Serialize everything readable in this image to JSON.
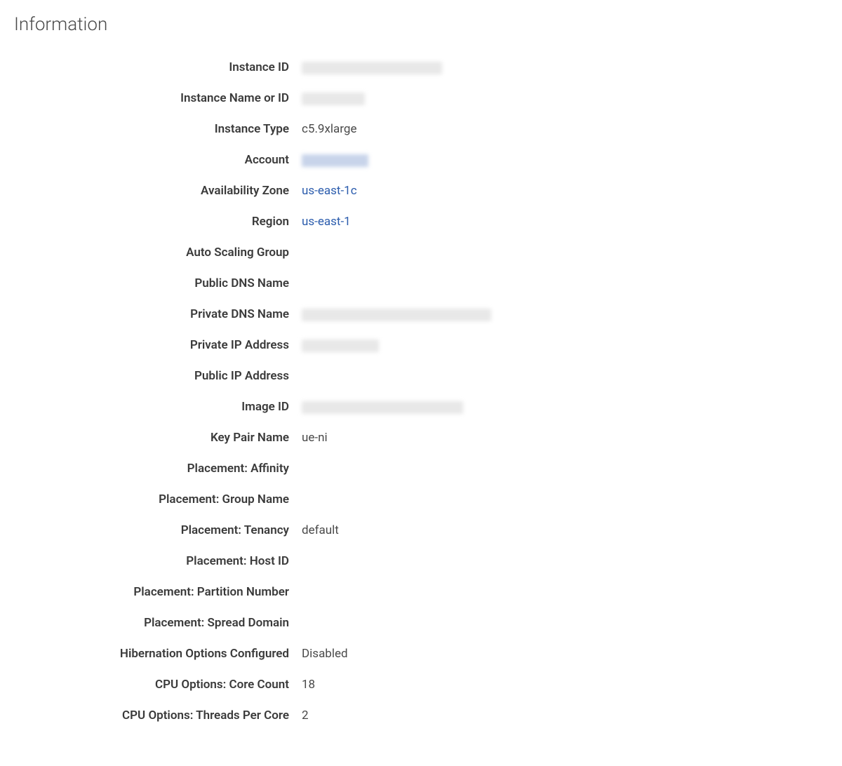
{
  "section": {
    "title": "Information"
  },
  "fields": {
    "instance_id": {
      "label": "Instance ID",
      "value": "",
      "redacted": "w1"
    },
    "instance_name_or_id": {
      "label": "Instance Name or ID",
      "value": "",
      "redacted": "w2"
    },
    "instance_type": {
      "label": "Instance Type",
      "value": "c5.9xlarge"
    },
    "account": {
      "label": "Account",
      "value": "",
      "redacted": "w3"
    },
    "availability_zone": {
      "label": "Availability Zone",
      "value": "us-east-1c",
      "link": true
    },
    "region": {
      "label": "Region",
      "value": "us-east-1",
      "link": true
    },
    "auto_scaling_group": {
      "label": "Auto Scaling Group",
      "value": ""
    },
    "public_dns_name": {
      "label": "Public DNS Name",
      "value": ""
    },
    "private_dns_name": {
      "label": "Private DNS Name",
      "value": "",
      "redacted": "w4"
    },
    "private_ip_address": {
      "label": "Private IP Address",
      "value": "",
      "redacted": "w5"
    },
    "public_ip_address": {
      "label": "Public IP Address",
      "value": ""
    },
    "image_id": {
      "label": "Image ID",
      "value": "",
      "redacted": "w6"
    },
    "key_pair_name": {
      "label": "Key Pair Name",
      "value": "ue-ni"
    },
    "placement_affinity": {
      "label": "Placement: Affinity",
      "value": ""
    },
    "placement_group_name": {
      "label": "Placement: Group Name",
      "value": ""
    },
    "placement_tenancy": {
      "label": "Placement: Tenancy",
      "value": "default"
    },
    "placement_host_id": {
      "label": "Placement: Host ID",
      "value": ""
    },
    "placement_partition_number": {
      "label": "Placement: Partition Number",
      "value": ""
    },
    "placement_spread_domain": {
      "label": "Placement: Spread Domain",
      "value": ""
    },
    "hibernation_options_configured": {
      "label": "Hibernation Options Configured",
      "value": "Disabled"
    },
    "cpu_options_core_count": {
      "label": "CPU Options: Core Count",
      "value": "18"
    },
    "cpu_options_threads_per_core": {
      "label": "CPU Options: Threads Per Core",
      "value": "2"
    }
  },
  "field_order": [
    "instance_id",
    "instance_name_or_id",
    "instance_type",
    "account",
    "availability_zone",
    "region",
    "auto_scaling_group",
    "public_dns_name",
    "private_dns_name",
    "private_ip_address",
    "public_ip_address",
    "image_id",
    "key_pair_name",
    "placement_affinity",
    "placement_group_name",
    "placement_tenancy",
    "placement_host_id",
    "placement_partition_number",
    "placement_spread_domain",
    "hibernation_options_configured",
    "cpu_options_core_count",
    "cpu_options_threads_per_core"
  ]
}
